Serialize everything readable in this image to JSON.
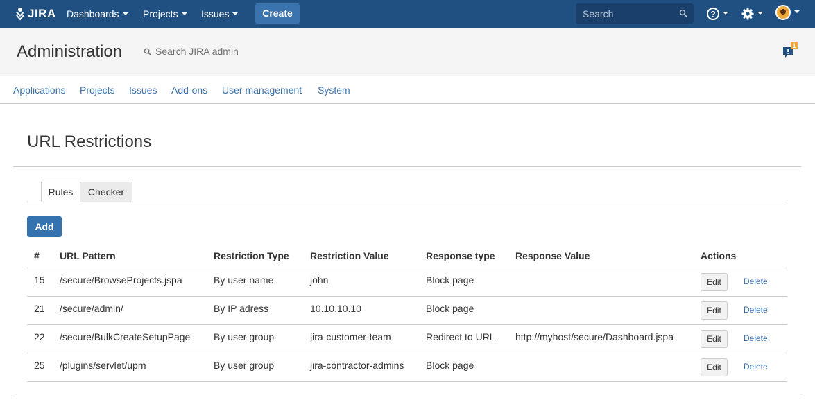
{
  "topnav": {
    "logo_text": "JIRA",
    "items": [
      "Dashboards",
      "Projects",
      "Issues"
    ],
    "create_label": "Create",
    "search_placeholder": "Search",
    "bg_color": "#205081"
  },
  "admin": {
    "title": "Administration",
    "search_label": "Search JIRA admin",
    "notification_count": "1"
  },
  "subnav": {
    "items": [
      "Applications",
      "Projects",
      "Issues",
      "Add-ons",
      "User management",
      "System"
    ]
  },
  "page": {
    "title": "URL Restrictions",
    "tabs": [
      "Rules",
      "Checker"
    ],
    "add_label": "Add"
  },
  "table": {
    "headers": [
      "#",
      "URL Pattern",
      "Restriction Type",
      "Restriction Value",
      "Response type",
      "Response Value",
      "Actions"
    ],
    "rows": [
      {
        "id": "15",
        "pattern": "/secure/BrowseProjects.jspa",
        "type": "By user name",
        "value": "john",
        "response_type": "Block page",
        "response_value": "",
        "edit": "Edit",
        "delete": "Delete"
      },
      {
        "id": "21",
        "pattern": "/secure/admin/",
        "type": "By IP adress",
        "value": "10.10.10.10",
        "response_type": "Block page",
        "response_value": "",
        "edit": "Edit",
        "delete": "Delete"
      },
      {
        "id": "22",
        "pattern": "/secure/BulkCreateSetupPage",
        "type": "By user group",
        "value": "jira-customer-team",
        "response_type": "Redirect to URL",
        "response_value": "http://myhost/secure/Dashboard.jspa",
        "edit": "Edit",
        "delete": "Delete"
      },
      {
        "id": "25",
        "pattern": "/plugins/servlet/upm",
        "type": "By user group",
        "value": "jira-contractor-admins",
        "response_type": "Block page",
        "response_value": "",
        "edit": "Edit",
        "delete": "Delete"
      }
    ]
  }
}
